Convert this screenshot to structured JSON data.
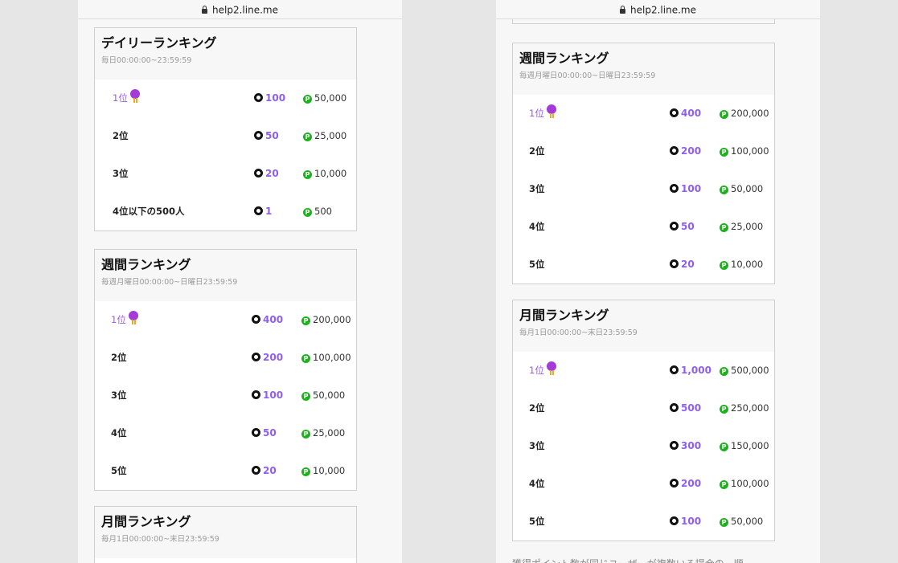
{
  "browser": {
    "url": "help2.line.me"
  },
  "left": {
    "daily": {
      "title": "デイリーランキング",
      "period": "毎日00:00:00~23:59:59",
      "rows": [
        {
          "rank": "1位",
          "points": "100",
          "prize": "50,000"
        },
        {
          "rank": "2位",
          "points": "50",
          "prize": "25,000"
        },
        {
          "rank": "3位",
          "points": "20",
          "prize": "10,000"
        },
        {
          "rank": "4位以下の500人",
          "points": "1",
          "prize": "500"
        }
      ]
    },
    "weekly": {
      "title": "週間ランキング",
      "period": "毎週月曜日00:00:00~日曜日23:59:59",
      "rows": [
        {
          "rank": "1位",
          "points": "400",
          "prize": "200,000"
        },
        {
          "rank": "2位",
          "points": "200",
          "prize": "100,000"
        },
        {
          "rank": "3位",
          "points": "100",
          "prize": "50,000"
        },
        {
          "rank": "4位",
          "points": "50",
          "prize": "25,000"
        },
        {
          "rank": "5位",
          "points": "20",
          "prize": "10,000"
        }
      ]
    },
    "monthly": {
      "title": "月間ランキング",
      "period": "毎月1日00:00:00~末日23:59:59"
    }
  },
  "right": {
    "weekly": {
      "title": "週間ランキング",
      "period": "毎週月曜日00:00:00~日曜日23:59:59",
      "rows": [
        {
          "rank": "1位",
          "points": "400",
          "prize": "200,000"
        },
        {
          "rank": "2位",
          "points": "200",
          "prize": "100,000"
        },
        {
          "rank": "3位",
          "points": "100",
          "prize": "50,000"
        },
        {
          "rank": "4位",
          "points": "50",
          "prize": "25,000"
        },
        {
          "rank": "5位",
          "points": "20",
          "prize": "10,000"
        }
      ]
    },
    "monthly": {
      "title": "月間ランキング",
      "period": "毎月1日00:00:00~末日23:59:59",
      "rows": [
        {
          "rank": "1位",
          "points": "1,000",
          "prize": "500,000"
        },
        {
          "rank": "2位",
          "points": "500",
          "prize": "250,000"
        },
        {
          "rank": "3位",
          "points": "300",
          "prize": "150,000"
        },
        {
          "rank": "4位",
          "points": "200",
          "prize": "100,000"
        },
        {
          "rank": "5位",
          "points": "100",
          "prize": "50,000"
        }
      ]
    },
    "footer_text": "獲得ポイント数が同じユーザーが複数いる場合の、順"
  },
  "icons": {
    "rank_first": "medal-icon",
    "points": "point-ring-icon",
    "prize": "line-point-coin-icon"
  },
  "colors": {
    "first_rank": "#9b5de5",
    "points": "#8e5ef0",
    "coin": "#1db21d",
    "medal": "#a43ad8",
    "ribbon": "#f0a81c"
  }
}
